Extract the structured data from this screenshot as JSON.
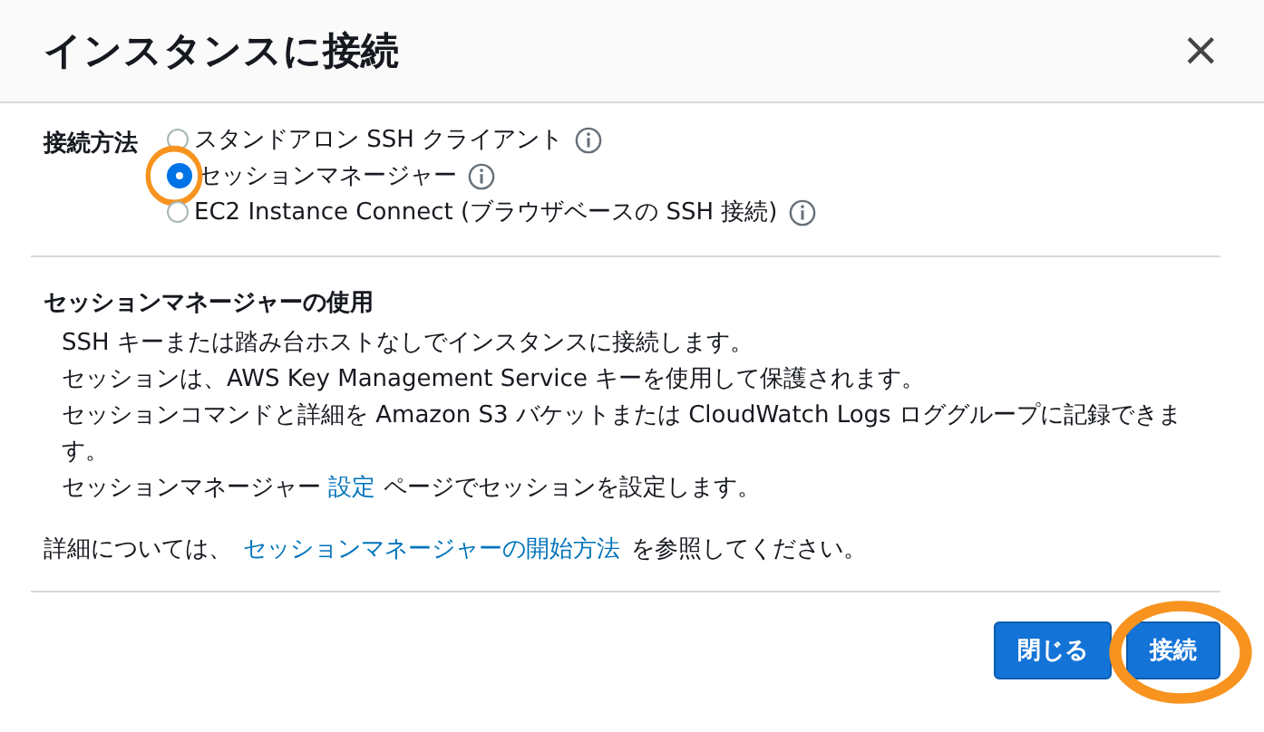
{
  "dialog": {
    "title": "インスタンスに接続",
    "close": "×"
  },
  "connection_method": {
    "label": "接続方法",
    "options": [
      {
        "label": "スタンドアロン SSH クライアント",
        "selected": false,
        "highlighted": false
      },
      {
        "label": "セッションマネージャー",
        "selected": true,
        "highlighted": true
      },
      {
        "label": "EC2 Instance Connect (ブラウザベースの SSH 接続)",
        "selected": false,
        "highlighted": false
      }
    ]
  },
  "usage": {
    "heading": "セッションマネージャーの使用",
    "lines": [
      {
        "text": "SSH キーまたは踏み台ホストなしでインスタンスに接続します。"
      },
      {
        "text": "セッションは、AWS Key Management Service キーを使用して保護されます。"
      },
      {
        "text": "セッションコマンドと詳細を Amazon S3 バケットまたは CloudWatch Logs ロググループに記録できます。"
      },
      {
        "text": "セッションマネージャー",
        "link": "設定",
        "after": "ページでセッションを設定します。"
      }
    ]
  },
  "more_info": {
    "text": "詳細については、",
    "link": "セッションマネージャーの開始方法",
    "after": "を参照してください。"
  },
  "buttons": [
    {
      "label": "閉じる",
      "highlighted": false
    },
    {
      "label": "接続",
      "highlighted": true
    }
  ]
}
